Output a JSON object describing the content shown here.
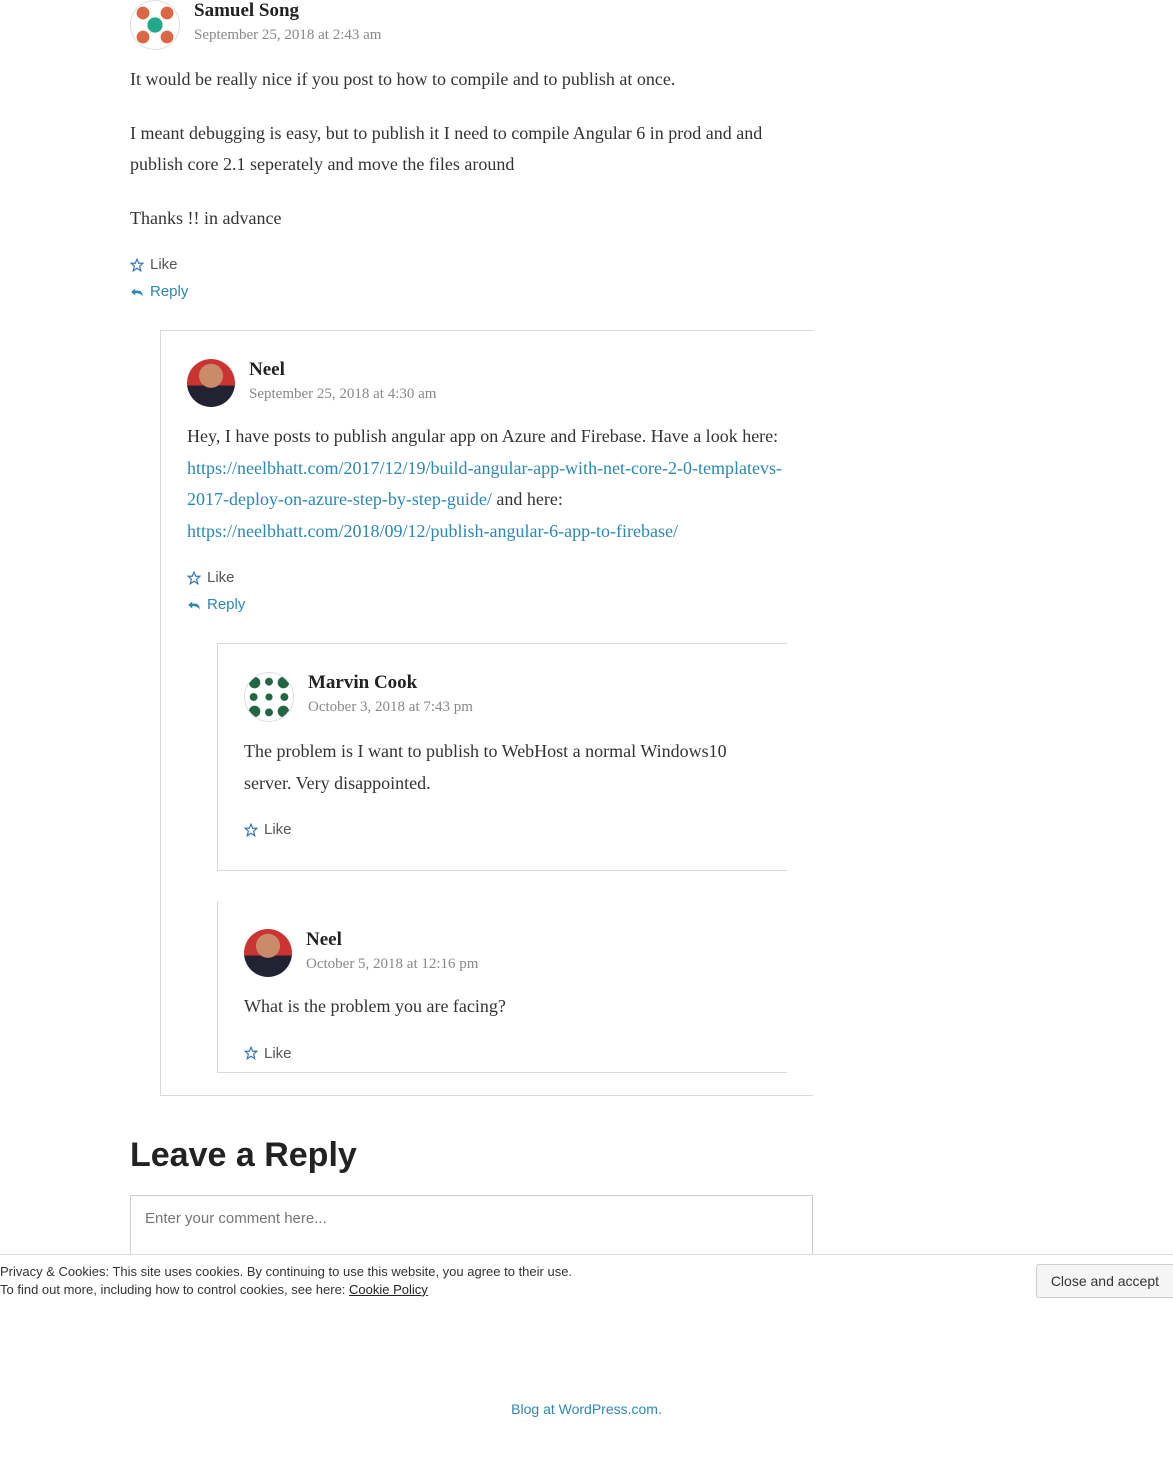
{
  "comments": [
    {
      "author": "Samuel Song",
      "timestamp": "September 25, 2018 at 2:43 am",
      "paragraphs": [
        "It would be really nice if you post to how to compile and to publish at once.",
        "I meant debugging is easy, but to publish it I need to compile Angular 6 in prod and and publish core 2.1 seperately and move the files around",
        "Thanks !! in advance"
      ],
      "like": "Like",
      "reply": "Reply"
    },
    {
      "author": "Neel",
      "timestamp": "September 25, 2018 at 4:30 am",
      "intro": "Hey, I have posts to publish angular app on Azure and Firebase. Have a look here: ",
      "link1": "https://neelbhatt.com/2017/12/19/build-angular-app-with-net-core-2-0-templatevs-2017-deploy-on-azure-step-by-step-guide/",
      "mid": " and here: ",
      "link2": "https://neelbhatt.com/2018/09/12/publish-angular-6-app-to-firebase/",
      "like": "Like",
      "reply": "Reply"
    },
    {
      "author": "Marvin Cook",
      "timestamp": "October 3, 2018 at 7:43 pm",
      "paragraphs": [
        "The problem is I want to publish to WebHost a normal Windows10 server. Very disappointed."
      ],
      "like": "Like"
    },
    {
      "author": "Neel",
      "timestamp": "October 5, 2018 at 12:16 pm",
      "paragraphs": [
        "What is the problem you are facing?"
      ],
      "like": "Like"
    }
  ],
  "replyForm": {
    "heading": "Leave a Reply",
    "placeholder": "Enter your comment here..."
  },
  "footer": {
    "blogLink": "Blog at WordPress.com."
  },
  "cookie": {
    "line1": "Privacy & Cookies: This site uses cookies. By continuing to use this website, you agree to their use.",
    "line2a": "To find out more, including how to control cookies, see here: ",
    "policy": "Cookie Policy",
    "close": "Close and accept"
  }
}
